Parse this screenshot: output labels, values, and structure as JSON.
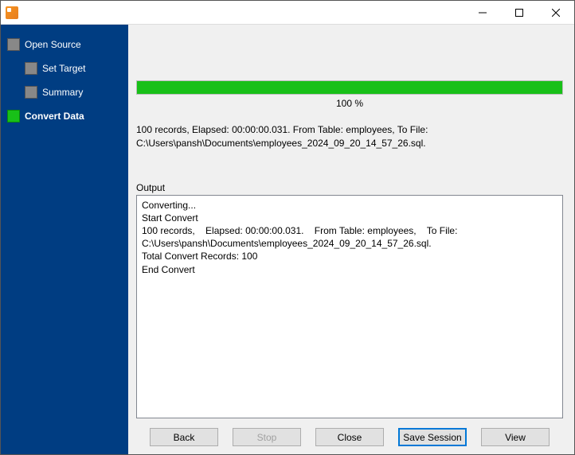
{
  "sidebar": {
    "items": [
      {
        "label": "Open Source"
      },
      {
        "label": "Set Target"
      },
      {
        "label": "Summary"
      },
      {
        "label": "Convert Data"
      }
    ]
  },
  "progress": {
    "percent_text": "100 %",
    "width": "100%"
  },
  "summary": {
    "line": "100 records,    Elapsed: 00:00:00.031.    From Table: employees,    To File: C:\\Users\\pansh\\Documents\\employees_2024_09_20_14_57_26.sql."
  },
  "output": {
    "label": "Output",
    "text": "Converting...\nStart Convert\n100 records,    Elapsed: 00:00:00.031.    From Table: employees,    To File: C:\\Users\\pansh\\Documents\\employees_2024_09_20_14_57_26.sql.\nTotal Convert Records: 100\nEnd Convert"
  },
  "buttons": {
    "back": "Back",
    "stop": "Stop",
    "close": "Close",
    "save_session": "Save Session",
    "view": "View"
  }
}
